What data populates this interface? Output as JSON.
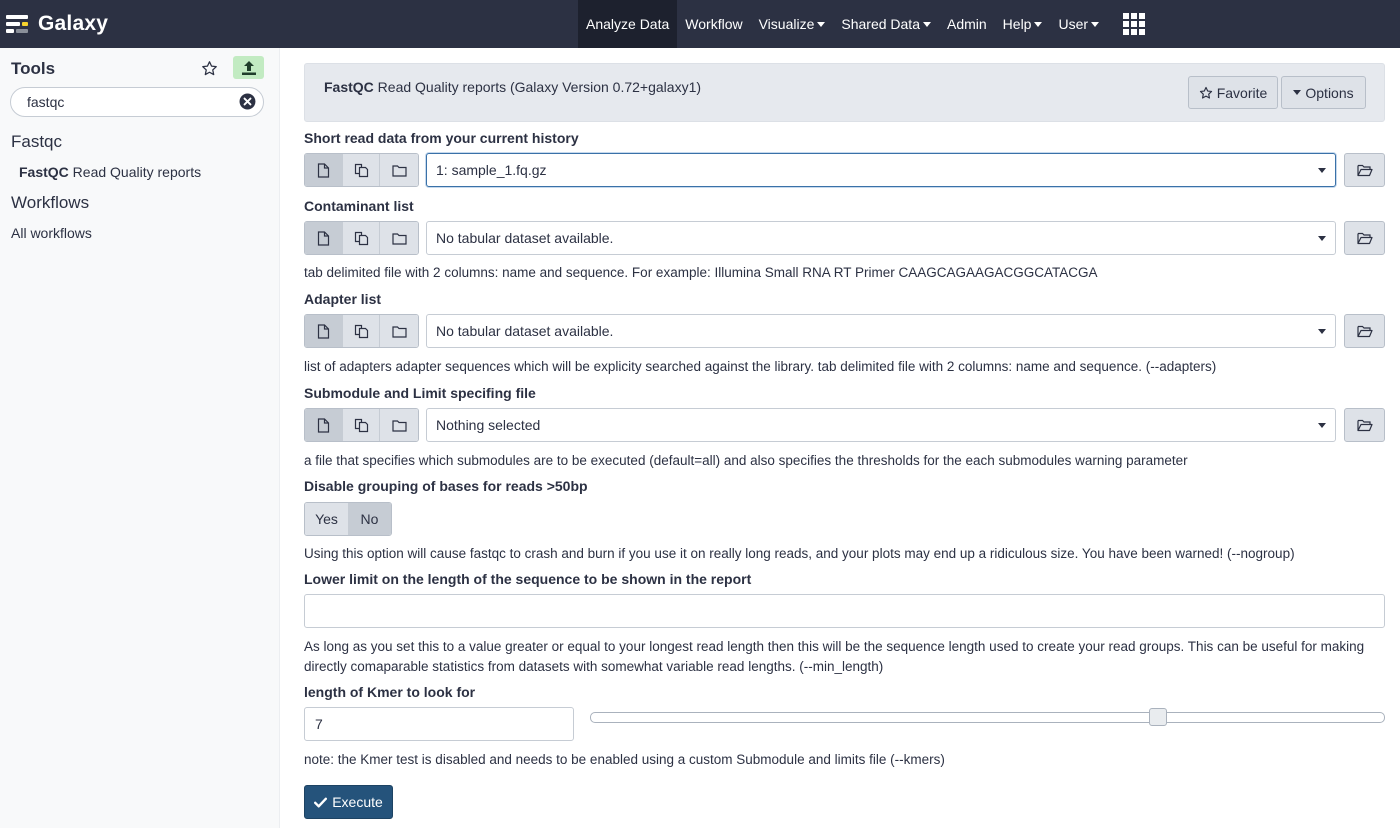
{
  "navbar": {
    "brand": "Galaxy",
    "items": [
      {
        "label": "Analyze Data",
        "active": true,
        "dropdown": false
      },
      {
        "label": "Workflow",
        "active": false,
        "dropdown": false
      },
      {
        "label": "Visualize",
        "active": false,
        "dropdown": true
      },
      {
        "label": "Shared Data",
        "active": false,
        "dropdown": true
      },
      {
        "label": "Admin",
        "active": false,
        "dropdown": false
      },
      {
        "label": "Help",
        "active": false,
        "dropdown": true
      },
      {
        "label": "User",
        "active": false,
        "dropdown": true
      }
    ]
  },
  "tool_panel": {
    "title": "Tools",
    "search_value": "fastqc",
    "section_title": "Fastqc",
    "tool_name": "FastQC",
    "tool_desc": " Read Quality reports",
    "workflows_title": "Workflows",
    "workflows_link": "All workflows"
  },
  "tool_form": {
    "header_name": "FastQC",
    "header_desc": " Read Quality reports (Galaxy Version 0.72+galaxy1)",
    "favorite_label": "Favorite",
    "options_label": "Options",
    "params": {
      "short_read": {
        "label": "Short read data from your current history",
        "value": "1: sample_1.fq.gz"
      },
      "contaminant": {
        "label": "Contaminant list",
        "value": "No tabular dataset available.",
        "help": "tab delimited file with 2 columns: name and sequence. For example: Illumina Small RNA RT Primer CAAGCAGAAGACGGCATACGA"
      },
      "adapter": {
        "label": "Adapter list",
        "value": "No tabular dataset available.",
        "help": "list of adapters adapter sequences which will be explicity searched against the library. tab delimited file with 2 columns: name and sequence. (--adapters)"
      },
      "limits": {
        "label": "Submodule and Limit specifing file",
        "value": "Nothing selected",
        "help": "a file that specifies which submodules are to be executed (default=all) and also specifies the thresholds for the each submodules warning parameter"
      },
      "nogroup": {
        "label": "Disable grouping of bases for reads >50bp",
        "yes": "Yes",
        "no": "No",
        "selected": "No",
        "help": "Using this option will cause fastqc to crash and burn if you use it on really long reads, and your plots may end up a ridiculous size. You have been warned! (--nogroup)"
      },
      "min_length": {
        "label": "Lower limit on the length of the sequence to be shown in the report",
        "value": "",
        "help": "As long as you set this to a value greater or equal to your longest read length then this will be the sequence length used to create your read groups. This can be useful for making directly comaparable statistics from datasets with somewhat variable read lengths. (--min_length)"
      },
      "kmers": {
        "label": "length of Kmer to look for",
        "value": "7",
        "slider_fraction": 0.72,
        "help": "note: the Kmer test is disabled and needs to be enabled using a custom Submodule and limits file (--kmers)"
      }
    },
    "execute_label": "Execute"
  }
}
